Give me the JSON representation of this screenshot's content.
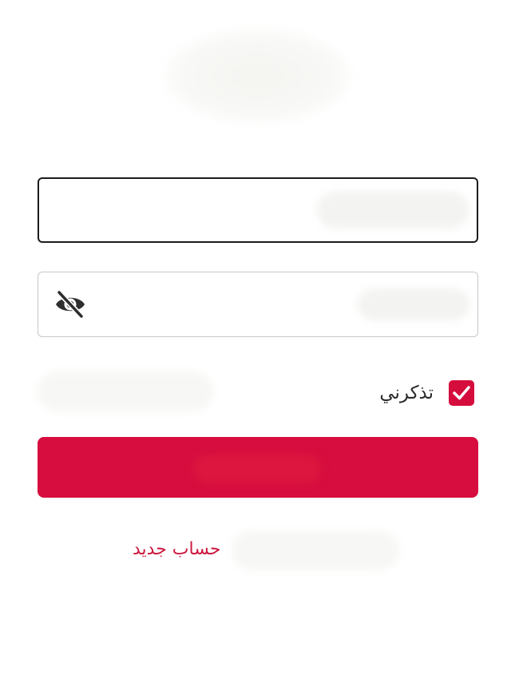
{
  "app": {
    "logo": "logo-blurred"
  },
  "form": {
    "username_field": {
      "value": "",
      "placeholder": ""
    },
    "password_field": {
      "value": "",
      "placeholder": ""
    },
    "password_toggle_icon": "eye-off-icon",
    "remember_me": {
      "label": "تذكرني",
      "checked": true
    },
    "login_button": {
      "label": ""
    }
  },
  "footer": {
    "new_account_link": "حساب جديد"
  },
  "colors": {
    "accent": "#d60d3e",
    "link": "#cc1840",
    "input_border_focused": "#1c1c1c",
    "input_border": "#c7c7c7"
  }
}
